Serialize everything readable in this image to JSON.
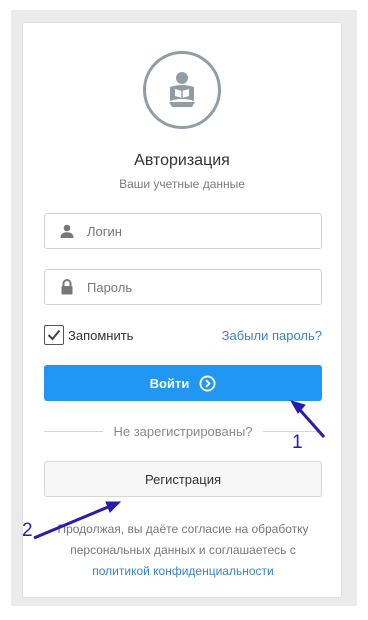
{
  "auth": {
    "title": "Авторизация",
    "subtitle": "Ваши учетные данные"
  },
  "fields": {
    "login_placeholder": "Логин",
    "password_placeholder": "Пароль"
  },
  "remember": {
    "label": "Запомнить",
    "checked": true
  },
  "links": {
    "forgot": "Забыли пароль?"
  },
  "buttons": {
    "login": "Войти",
    "register": "Регистрация"
  },
  "divider": {
    "text": "Не зарегистрированы?"
  },
  "consent": {
    "text": "Продолжая, вы даёте согласие на обработку персональных данных и соглашаетесь с",
    "link": "политикой конфиденциальности"
  },
  "annotations": {
    "marker1": "1",
    "marker2": "2",
    "arrow_color": "#2a1ab0"
  },
  "icons": {
    "avatar": "user-reading-icon",
    "login_field": "user-icon",
    "password_field": "lock-icon",
    "checkbox": "check-icon",
    "login_button": "chevron-right-circle-icon"
  },
  "colors": {
    "primary": "#2196f3",
    "link": "#3b83c5",
    "avatar": "#909da3"
  }
}
